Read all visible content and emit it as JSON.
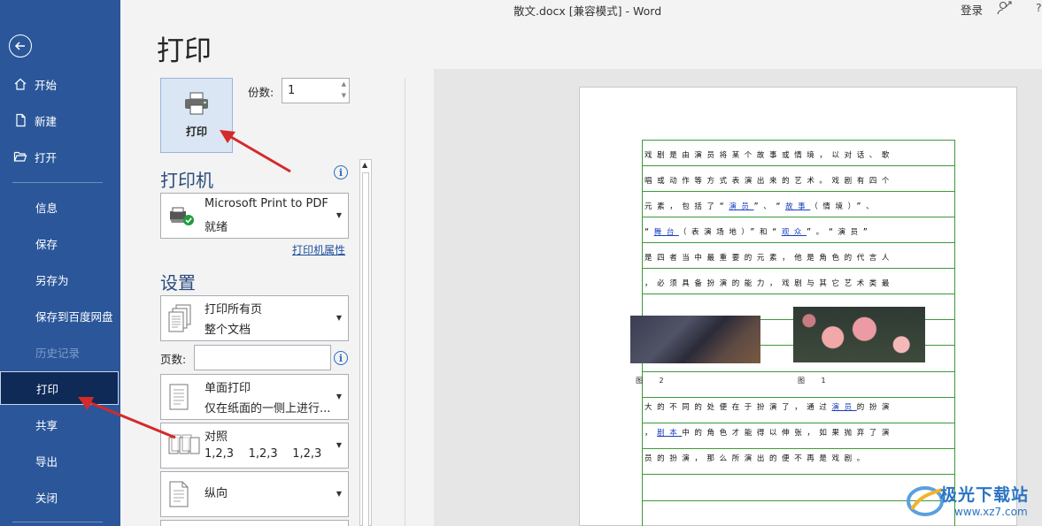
{
  "titlebar": {
    "title": "散文.docx [兼容模式] - Word",
    "login": "登录",
    "help": "?"
  },
  "sidebar": {
    "items": [
      {
        "label": "开始"
      },
      {
        "label": "新建"
      },
      {
        "label": "打开"
      },
      {
        "label": "信息"
      },
      {
        "label": "保存"
      },
      {
        "label": "另存为"
      },
      {
        "label": "保存到百度网盘"
      },
      {
        "label": "历史记录"
      },
      {
        "label": "打印"
      },
      {
        "label": "共享"
      },
      {
        "label": "导出"
      },
      {
        "label": "关闭"
      }
    ]
  },
  "main": {
    "title": "打印",
    "print_button": "打印",
    "copies_label": "份数:",
    "copies_value": "1",
    "printer_section": "打印机",
    "printer_name": "Microsoft Print to PDF",
    "printer_status": "就绪",
    "printer_props": "打印机属性",
    "settings_section": "设置",
    "setting_pages_l1": "打印所有页",
    "setting_pages_l2": "整个文档",
    "pages_label": "页数:",
    "setting_sides_l1": "单面打印",
    "setting_sides_l2": "仅在纸面的一侧上进行...",
    "setting_collate_l1": "对照",
    "setting_collate_l2": "1,2,3    1,2,3    1,2,3",
    "setting_orient_l1": "纵向"
  },
  "preview": {
    "line1": "戏剧是由演员将某个故事或情境，以对话、歌",
    "line2a": "唱或动作等方式表",
    "line2b": "演出来的艺术。戏剧有四个",
    "line3a": "元素，包括了“",
    "line3_link1": "演员",
    "line3b": "”、“",
    "line3_link2": "故事",
    "line3c": "（情境）”、",
    "line4a": "“",
    "line4_link1": "舞台",
    "line4b": "（表演场地）”和“",
    "line4_link2": "观众",
    "line4c": "”。“演员”",
    "line5": "是四者当中最重要的元素，他是角色的代言人",
    "line6": "，必须具备扮演的能力，戏剧与其它艺术类最",
    "caption1": "图 2",
    "caption2": "图 1",
    "line7a": "大的不同的处便在于扮演了，通过",
    "line7_link": "演员",
    "line7b": "的扮演",
    "line8a": "，",
    "line8_link": "剧本",
    "line8b": "中的角色才能得以伸张，如果抛弃了演",
    "line9": "员的扮演，那么所演出的便不再是戏剧。"
  },
  "watermark": {
    "brand": "极光下载站",
    "url": "www.xz7.com"
  }
}
